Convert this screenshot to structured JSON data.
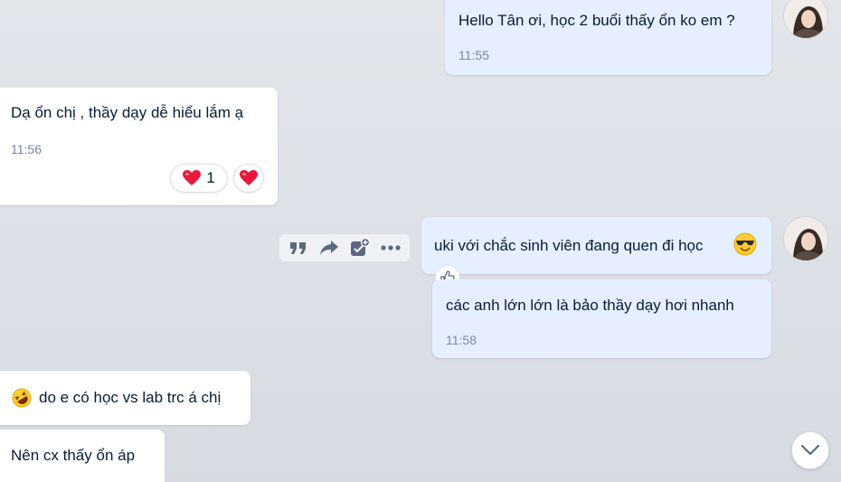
{
  "messages": [
    {
      "direction": "outgoing",
      "text": "Hello Tân ơi, học 2 buổi thấy ổn ko em ?",
      "time": "11:55"
    },
    {
      "direction": "incoming",
      "text": "Dạ ổn chị , thầy dạy dễ hiểu lắm ạ",
      "time": "11:56",
      "reactions": [
        {
          "icon": "heart",
          "count": "1"
        },
        {
          "icon": "heart",
          "count": ""
        }
      ]
    },
    {
      "direction": "outgoing",
      "text": "uki với chắc sinh viên đang quen đi học",
      "emoji": "smiling-face-with-sunglasses"
    },
    {
      "direction": "outgoing",
      "text": "các anh lớn lớn là bảo thầy dạy hơi nhanh",
      "time": "11:58"
    },
    {
      "direction": "incoming",
      "text": "do e có học vs lab trc á chị",
      "emoji": "rolling-on-floor-laughing"
    },
    {
      "direction": "incoming",
      "text": "Nên cx thấy ổn áp"
    }
  ],
  "message_toolbar": {
    "actions": [
      "quote-icon",
      "forward-icon",
      "add-task-icon",
      "more-icon"
    ]
  },
  "colors": {
    "background": "#dde1e7",
    "incoming_bubble": "#ffffff",
    "outgoing_bubble": "#e5efff",
    "time_text": "#7589a3",
    "heart": "#e8193c"
  }
}
